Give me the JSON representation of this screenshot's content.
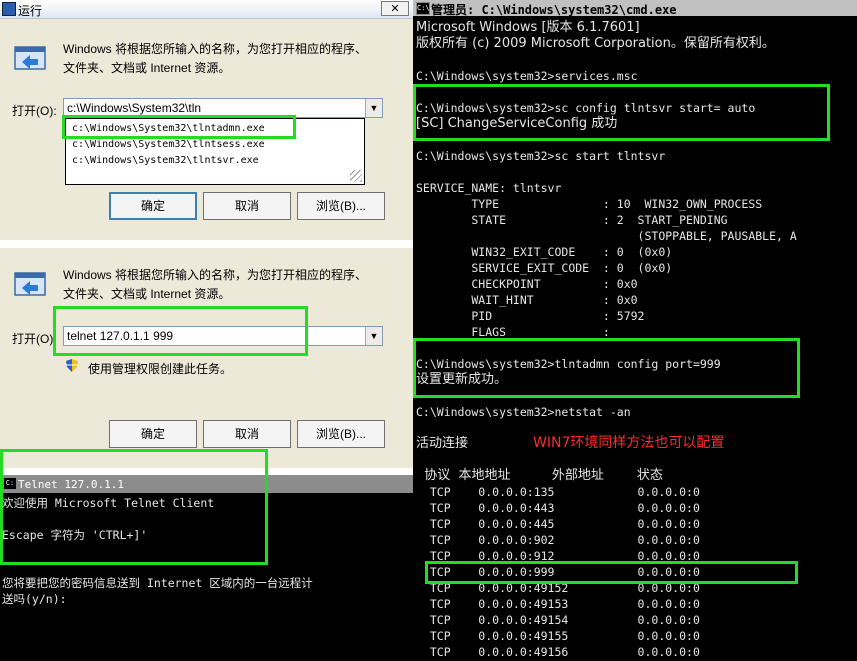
{
  "run1": {
    "title": "运行",
    "close": "✕",
    "description": "Windows 将根据您所输入的名称，为您打开相应的程序、\n文件夹、文档或 Internet 资源。",
    "open_label": "打开(O):",
    "input_value": "c:\\Windows\\System32\\tln",
    "suggestions": [
      "c:\\Windows\\System32\\tlntadmn.exe",
      "c:\\Windows\\System32\\tlntsess.exe",
      "c:\\Windows\\System32\\tlntsvr.exe"
    ],
    "ok": "确定",
    "cancel": "取消",
    "browse": "浏览(B)..."
  },
  "run2": {
    "description": "Windows 将根据您所输入的名称，为您打开相应的程序、\n文件夹、文档或 Internet 资源。",
    "open_label": "打开(O):",
    "input_value": "telnet 127.0.1.1 999",
    "admin_note": "使用管理权限创建此任务。",
    "ok": "确定",
    "cancel": "取消",
    "browse": "浏览(B)..."
  },
  "telnet": {
    "title": "Telnet 127.0.1.1",
    "lines": [
      "欢迎使用 Microsoft Telnet Client",
      "",
      "Escape 字符为 'CTRL+]'",
      "",
      "",
      "您将要把您的密码信息送到 Internet 区域内的一台远程计",
      "送吗(y/n):"
    ]
  },
  "cmd": {
    "title": "管理员: C:\\Windows\\system32\\cmd.exe",
    "lines": [
      "Microsoft Windows [版本 6.1.7601]",
      "版权所有 (c) 2009 Microsoft Corporation。保留所有权利。",
      "",
      "C:\\Windows\\system32>services.msc",
      "",
      "C:\\Windows\\system32>sc config tlntsvr start= auto",
      "[SC] ChangeServiceConfig 成功",
      "",
      "C:\\Windows\\system32>sc start tlntsvr",
      "",
      "SERVICE_NAME: tlntsvr",
      "        TYPE               : 10  WIN32_OWN_PROCESS",
      "        STATE              : 2  START_PENDING",
      "                                (STOPPABLE, PAUSABLE, A",
      "        WIN32_EXIT_CODE    : 0  (0x0)",
      "        SERVICE_EXIT_CODE  : 0  (0x0)",
      "        CHECKPOINT         : 0x0",
      "        WAIT_HINT          : 0x0",
      "        PID                : 5792",
      "        FLAGS              :",
      "",
      "C:\\Windows\\system32>tlntadmn config port=999",
      "设置更新成功。",
      "",
      "C:\\Windows\\system32>netstat -an",
      "",
      "活动连接",
      "",
      "  协议  本地地址          外部地址        状态",
      "  TCP    0.0.0.0:135            0.0.0.0:0",
      "  TCP    0.0.0.0:443            0.0.0.0:0",
      "  TCP    0.0.0.0:445            0.0.0.0:0",
      "  TCP    0.0.0.0:902            0.0.0.0:0",
      "  TCP    0.0.0.0:912            0.0.0.0:0",
      "  TCP    0.0.0.0:999            0.0.0.0:0",
      "  TCP    0.0.0.0:49152          0.0.0.0:0",
      "  TCP    0.0.0.0:49153          0.0.0.0:0",
      "  TCP    0.0.0.0:49154          0.0.0.0:0",
      "  TCP    0.0.0.0:49155          0.0.0.0:0",
      "  TCP    0.0.0.0:49156          0.0.0.0:0"
    ],
    "annotation": "WIN7环境同样方法也可以配置"
  },
  "colors": {
    "highlight": "#22dd22",
    "annotation": "#ff2a2a",
    "console_text": "#e6e6e6"
  }
}
